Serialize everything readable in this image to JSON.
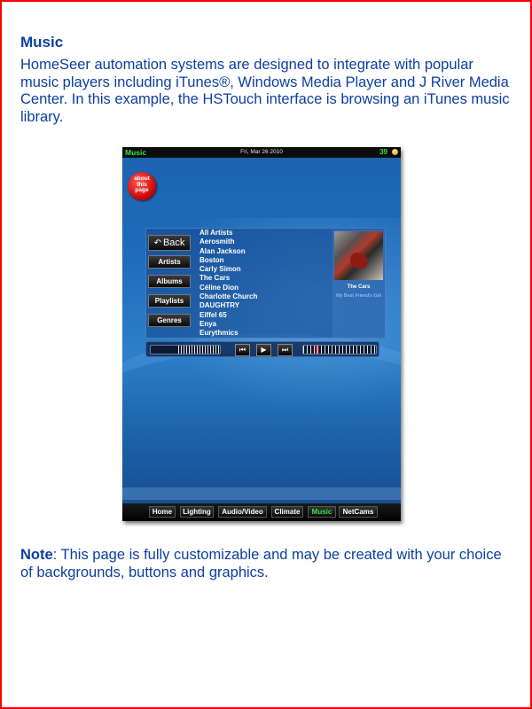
{
  "heading": "Music",
  "intro": "HomeSeer automation systems are designed to integrate with popular music players including iTunes®, Windows Media Player and J River Media Center.  In this example, the HSTouch interface is browsing an iTunes music library.",
  "note": {
    "label": "Note",
    "text": ": This page is fully customizable and may be created with your choice of backgrounds, buttons and graphics."
  },
  "device": {
    "title": "Music",
    "date": "Fri, Mar 26 2010",
    "temperature": "39",
    "about_button": [
      "about",
      "this",
      "page"
    ],
    "nav": {
      "back": "Back",
      "back_icon": "back-arrow-icon",
      "buttons": [
        "Artists",
        "Albums",
        "Playlists",
        "Genres"
      ]
    },
    "artists": [
      "All Artists",
      "Aerosmith",
      "Alan Jackson",
      "Boston",
      "Carly Simon",
      "The Cars",
      "Céline Dion",
      "Charlotte Church",
      "DAUGHTRY",
      "Eiffel 65",
      "Enya",
      "Eurythmics"
    ],
    "now_playing": {
      "artist": "The Cars",
      "song": "My Best Friend's Girl"
    },
    "transport": {
      "prev_icon": "previous-track-icon",
      "play_icon": "play-icon",
      "next_icon": "next-track-icon",
      "prev_symbol": "⏮",
      "play_symbol": "▶",
      "next_symbol": "⏭"
    },
    "tabs": [
      "Home",
      "Lighting",
      "Audio/Video",
      "Climate",
      "Music",
      "NetCams"
    ],
    "active_tab": "Music"
  },
  "colors": {
    "text_blue": "#0d3fa0",
    "border_red": "#ff0000",
    "accent_green": "#38e24a"
  }
}
